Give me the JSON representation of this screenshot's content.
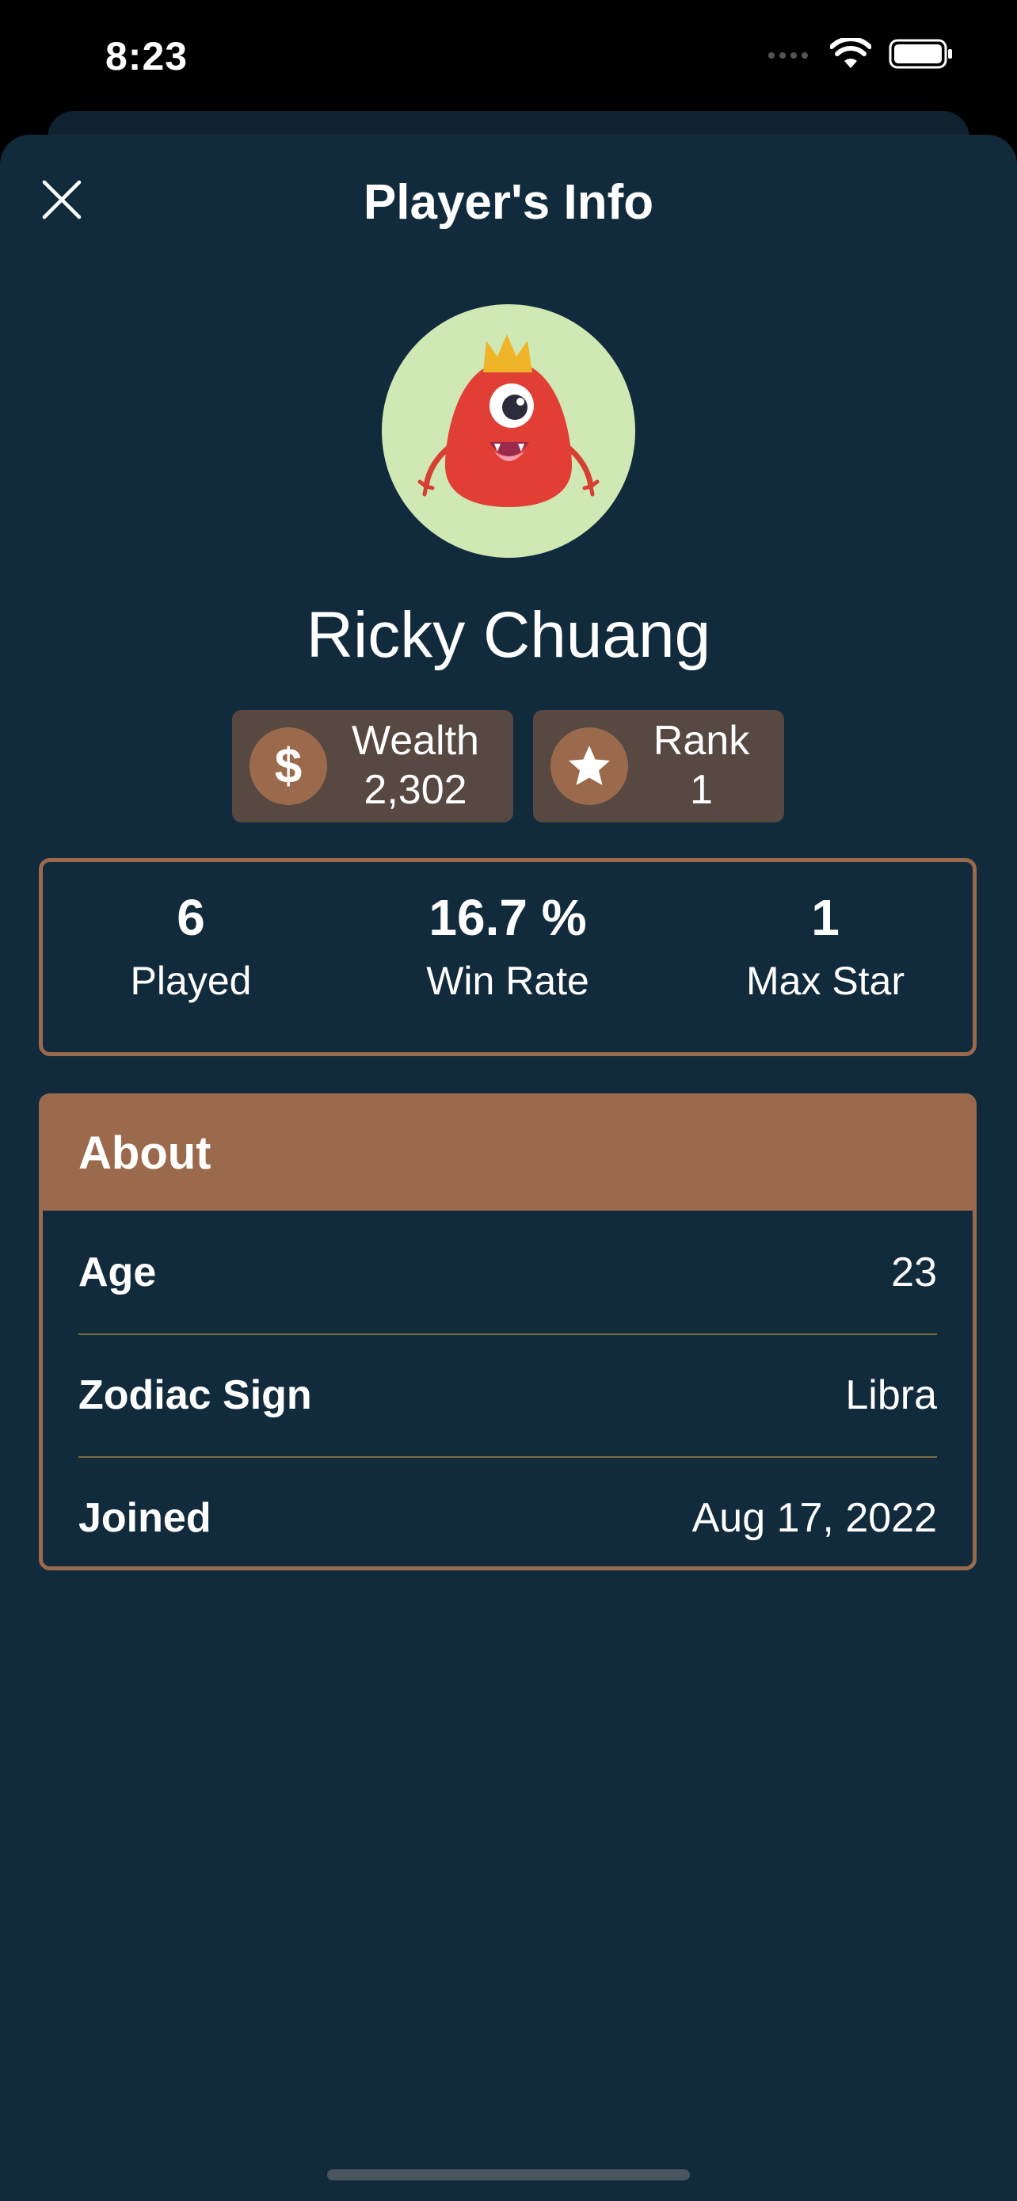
{
  "status_bar": {
    "time": "8:23"
  },
  "header": {
    "title": "Player's Info"
  },
  "player": {
    "name": "Ricky Chuang",
    "avatar_icon": "red-monster-with-crown"
  },
  "badges": {
    "wealth": {
      "label": "Wealth",
      "value": "2,302",
      "icon": "dollar-icon"
    },
    "rank": {
      "label": "Rank",
      "value": "1",
      "icon": "star-icon"
    }
  },
  "stats": [
    {
      "value": "6",
      "label": "Played"
    },
    {
      "value": "16.7 %",
      "label": "Win Rate"
    },
    {
      "value": "1",
      "label": "Max Star"
    }
  ],
  "about": {
    "title": "About",
    "rows": [
      {
        "label": "Age",
        "value": "23"
      },
      {
        "label": "Zodiac Sign",
        "value": "Libra"
      },
      {
        "label": "Joined",
        "value": "Aug 17, 2022"
      }
    ]
  },
  "colors": {
    "background": "#122b3c",
    "accent": "#9b6a4d",
    "pill": "#574841",
    "avatar_bg": "#cfe8b4"
  }
}
